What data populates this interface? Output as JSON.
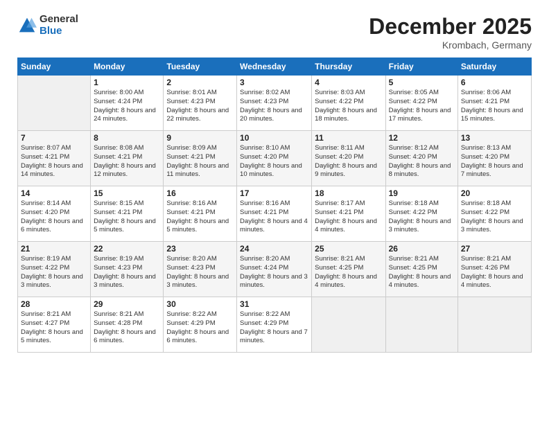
{
  "logo": {
    "general": "General",
    "blue": "Blue"
  },
  "header": {
    "month": "December 2025",
    "location": "Krombach, Germany"
  },
  "days_of_week": [
    "Sunday",
    "Monday",
    "Tuesday",
    "Wednesday",
    "Thursday",
    "Friday",
    "Saturday"
  ],
  "weeks": [
    [
      {
        "day": "",
        "info": ""
      },
      {
        "day": "1",
        "info": "Sunrise: 8:00 AM\nSunset: 4:24 PM\nDaylight: 8 hours\nand 24 minutes."
      },
      {
        "day": "2",
        "info": "Sunrise: 8:01 AM\nSunset: 4:23 PM\nDaylight: 8 hours\nand 22 minutes."
      },
      {
        "day": "3",
        "info": "Sunrise: 8:02 AM\nSunset: 4:23 PM\nDaylight: 8 hours\nand 20 minutes."
      },
      {
        "day": "4",
        "info": "Sunrise: 8:03 AM\nSunset: 4:22 PM\nDaylight: 8 hours\nand 18 minutes."
      },
      {
        "day": "5",
        "info": "Sunrise: 8:05 AM\nSunset: 4:22 PM\nDaylight: 8 hours\nand 17 minutes."
      },
      {
        "day": "6",
        "info": "Sunrise: 8:06 AM\nSunset: 4:21 PM\nDaylight: 8 hours\nand 15 minutes."
      }
    ],
    [
      {
        "day": "7",
        "info": "Sunrise: 8:07 AM\nSunset: 4:21 PM\nDaylight: 8 hours\nand 14 minutes."
      },
      {
        "day": "8",
        "info": "Sunrise: 8:08 AM\nSunset: 4:21 PM\nDaylight: 8 hours\nand 12 minutes."
      },
      {
        "day": "9",
        "info": "Sunrise: 8:09 AM\nSunset: 4:21 PM\nDaylight: 8 hours\nand 11 minutes."
      },
      {
        "day": "10",
        "info": "Sunrise: 8:10 AM\nSunset: 4:20 PM\nDaylight: 8 hours\nand 10 minutes."
      },
      {
        "day": "11",
        "info": "Sunrise: 8:11 AM\nSunset: 4:20 PM\nDaylight: 8 hours\nand 9 minutes."
      },
      {
        "day": "12",
        "info": "Sunrise: 8:12 AM\nSunset: 4:20 PM\nDaylight: 8 hours\nand 8 minutes."
      },
      {
        "day": "13",
        "info": "Sunrise: 8:13 AM\nSunset: 4:20 PM\nDaylight: 8 hours\nand 7 minutes."
      }
    ],
    [
      {
        "day": "14",
        "info": "Sunrise: 8:14 AM\nSunset: 4:20 PM\nDaylight: 8 hours\nand 6 minutes."
      },
      {
        "day": "15",
        "info": "Sunrise: 8:15 AM\nSunset: 4:21 PM\nDaylight: 8 hours\nand 5 minutes."
      },
      {
        "day": "16",
        "info": "Sunrise: 8:16 AM\nSunset: 4:21 PM\nDaylight: 8 hours\nand 5 minutes."
      },
      {
        "day": "17",
        "info": "Sunrise: 8:16 AM\nSunset: 4:21 PM\nDaylight: 8 hours\nand 4 minutes."
      },
      {
        "day": "18",
        "info": "Sunrise: 8:17 AM\nSunset: 4:21 PM\nDaylight: 8 hours\nand 4 minutes."
      },
      {
        "day": "19",
        "info": "Sunrise: 8:18 AM\nSunset: 4:22 PM\nDaylight: 8 hours\nand 3 minutes."
      },
      {
        "day": "20",
        "info": "Sunrise: 8:18 AM\nSunset: 4:22 PM\nDaylight: 8 hours\nand 3 minutes."
      }
    ],
    [
      {
        "day": "21",
        "info": "Sunrise: 8:19 AM\nSunset: 4:22 PM\nDaylight: 8 hours\nand 3 minutes."
      },
      {
        "day": "22",
        "info": "Sunrise: 8:19 AM\nSunset: 4:23 PM\nDaylight: 8 hours\nand 3 minutes."
      },
      {
        "day": "23",
        "info": "Sunrise: 8:20 AM\nSunset: 4:23 PM\nDaylight: 8 hours\nand 3 minutes."
      },
      {
        "day": "24",
        "info": "Sunrise: 8:20 AM\nSunset: 4:24 PM\nDaylight: 8 hours\nand 3 minutes."
      },
      {
        "day": "25",
        "info": "Sunrise: 8:21 AM\nSunset: 4:25 PM\nDaylight: 8 hours\nand 4 minutes."
      },
      {
        "day": "26",
        "info": "Sunrise: 8:21 AM\nSunset: 4:25 PM\nDaylight: 8 hours\nand 4 minutes."
      },
      {
        "day": "27",
        "info": "Sunrise: 8:21 AM\nSunset: 4:26 PM\nDaylight: 8 hours\nand 4 minutes."
      }
    ],
    [
      {
        "day": "28",
        "info": "Sunrise: 8:21 AM\nSunset: 4:27 PM\nDaylight: 8 hours\nand 5 minutes."
      },
      {
        "day": "29",
        "info": "Sunrise: 8:21 AM\nSunset: 4:28 PM\nDaylight: 8 hours\nand 6 minutes."
      },
      {
        "day": "30",
        "info": "Sunrise: 8:22 AM\nSunset: 4:29 PM\nDaylight: 8 hours\nand 6 minutes."
      },
      {
        "day": "31",
        "info": "Sunrise: 8:22 AM\nSunset: 4:29 PM\nDaylight: 8 hours\nand 7 minutes."
      },
      {
        "day": "",
        "info": ""
      },
      {
        "day": "",
        "info": ""
      },
      {
        "day": "",
        "info": ""
      }
    ]
  ]
}
